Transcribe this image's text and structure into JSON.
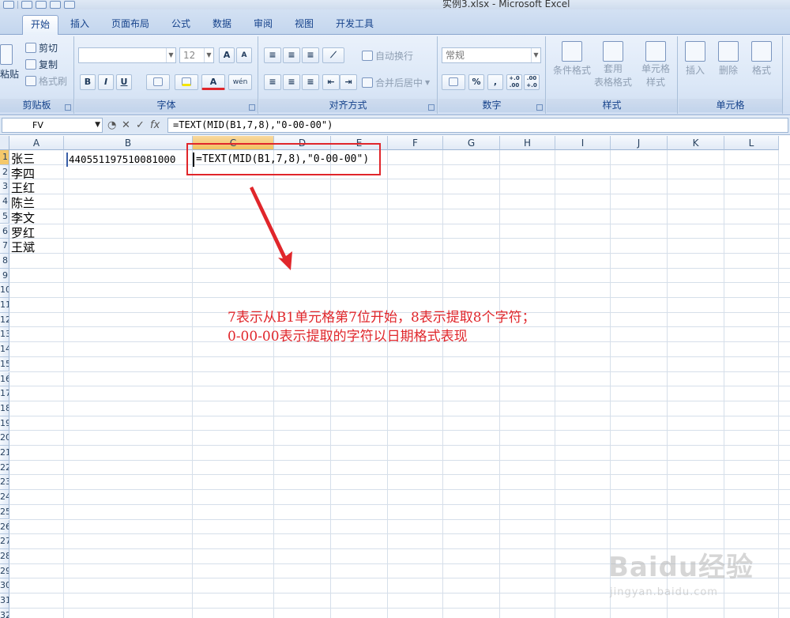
{
  "window": {
    "title": "实例3.xlsx - Microsoft Excel"
  },
  "tabs": [
    "开始",
    "插入",
    "页面布局",
    "公式",
    "数据",
    "审阅",
    "视图",
    "开发工具"
  ],
  "ribbon": {
    "clipboard": {
      "paste": "粘贴",
      "cut": "剪切",
      "copy": "复制",
      "format_painter": "格式刷",
      "label": "剪贴板"
    },
    "font": {
      "size": "12",
      "bold": "B",
      "italic": "I",
      "underline": "U",
      "grow": "A",
      "shrink": "A",
      "font_color": "A",
      "phonetic": "wén",
      "label": "字体"
    },
    "alignment": {
      "wrap": "自动换行",
      "merge": "合并后居中",
      "label": "对齐方式"
    },
    "number": {
      "format": "常规",
      "percent": "%",
      "comma": ",",
      "inc_dec": "+.0 .00",
      "dec_dec": ".00 +.0",
      "label": "数字"
    },
    "styles": {
      "conditional": "条件格式",
      "table_format_1": "套用",
      "table_format_2": "表格格式",
      "cell_style_1": "单元格",
      "cell_style_2": "样式",
      "label": "样式"
    },
    "cells": {
      "insert": "插入",
      "delete": "删除",
      "format": "格式",
      "label": "单元格"
    }
  },
  "formula_bar": {
    "name_box": "FV",
    "cancel": "✕",
    "enter": "✓",
    "fx": "fx",
    "formula": "=TEXT(MID(B1,7,8),\"0-00-00\")"
  },
  "columns": [
    "A",
    "B",
    "C",
    "D",
    "E",
    "F",
    "G",
    "H",
    "I",
    "J",
    "K",
    "L"
  ],
  "rows": [
    "1",
    "2",
    "3",
    "4",
    "5",
    "6",
    "7",
    "8",
    "9",
    "10",
    "11",
    "12",
    "13",
    "14",
    "15",
    "16",
    "17",
    "18",
    "19",
    "20",
    "21",
    "22",
    "23",
    "24",
    "25",
    "26",
    "27",
    "28",
    "29",
    "30",
    "31",
    "32"
  ],
  "cells": {
    "A": [
      "张三",
      "李四",
      "王红",
      "陈兰",
      "李文",
      "罗红",
      "王斌"
    ],
    "B1": "440551197510081000",
    "C1": "=TEXT(MID(B1,7,8),\"0-00-00\")"
  },
  "annotation": {
    "line1": "7表示从B1单元格第7位开始，8表示提取8个字符；",
    "line2": "0-00-00表示提取的字符以日期格式表现"
  },
  "watermark": {
    "main": "Baidu经验",
    "sub": "jingyan.baidu.com"
  },
  "colors": {
    "annotation": "#e0262b",
    "active_header": "#f1c15f"
  }
}
